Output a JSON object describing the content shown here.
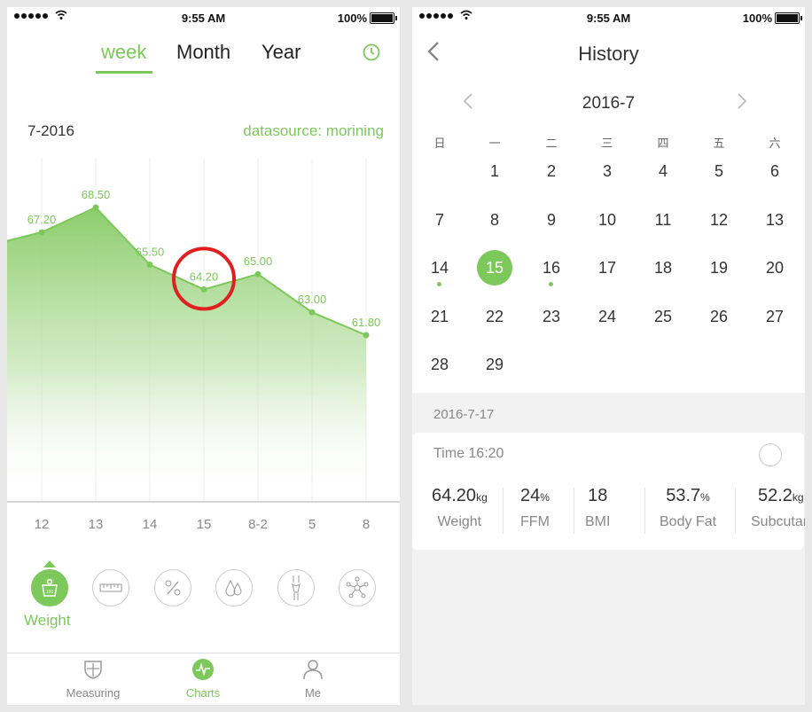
{
  "status_bar": {
    "time": "9:55 AM",
    "battery": "100%"
  },
  "charts_screen": {
    "tabs": [
      {
        "label": "week"
      },
      {
        "label": "Month"
      },
      {
        "label": "Year"
      }
    ],
    "active_tab": "week",
    "period": "7-2016",
    "datasource": "datasource:  morining",
    "metric_label": "Weight",
    "metric_buttons": [
      "weight-scale-icon",
      "ruler-icon",
      "percent-icon",
      "water-drop-icon",
      "body-icon",
      "molecule-icon"
    ],
    "nav": [
      {
        "label": "Measuring",
        "icon": "shield-icon"
      },
      {
        "label": "Charts",
        "icon": "heartbeat-icon"
      },
      {
        "label": "Me",
        "icon": "person-icon"
      }
    ],
    "accent_color": "#7cc85a",
    "highlight_color": "#e02020"
  },
  "chart_data": {
    "type": "area",
    "categories": [
      "12",
      "13",
      "14",
      "15",
      "8-2",
      "5",
      "8"
    ],
    "values": [
      67.2,
      68.5,
      65.5,
      64.2,
      65.0,
      63.0,
      61.8
    ],
    "value_labels": [
      "67.20",
      "68.50",
      "65.50",
      "64.20",
      "65.00",
      "63.00",
      "61.80"
    ],
    "highlighted_point": "64.20",
    "title": "",
    "xlabel": "",
    "ylabel": "",
    "grid": true
  },
  "history_screen": {
    "title": "History",
    "month": "2016-7",
    "weekdays": [
      "日",
      "一",
      "二",
      "三",
      "四",
      "五",
      "六"
    ],
    "days": [
      "1",
      "2",
      "3",
      "4",
      "5",
      "6",
      "7",
      "8",
      "9",
      "10",
      "11",
      "12",
      "13",
      "14",
      "15",
      "16",
      "17",
      "18",
      "19",
      "20",
      "21",
      "22",
      "23",
      "24",
      "25",
      "26",
      "27",
      "28",
      "29"
    ],
    "first_weekday_index": 1,
    "selected_day": "15",
    "marked_days": [
      "14",
      "16"
    ],
    "record_date": "2016-7-17",
    "record_time": "Time 16:20",
    "stats": [
      {
        "value": "64.20",
        "unit": "kg",
        "name": "Weight"
      },
      {
        "value": "24",
        "unit": "%",
        "name": "FFM"
      },
      {
        "value": "18",
        "unit": "",
        "name": "BMI"
      },
      {
        "value": "53.7",
        "unit": "%",
        "name": "Body Fat"
      },
      {
        "value": "52.2",
        "unit": "kg",
        "name": "Subcutan"
      }
    ]
  }
}
